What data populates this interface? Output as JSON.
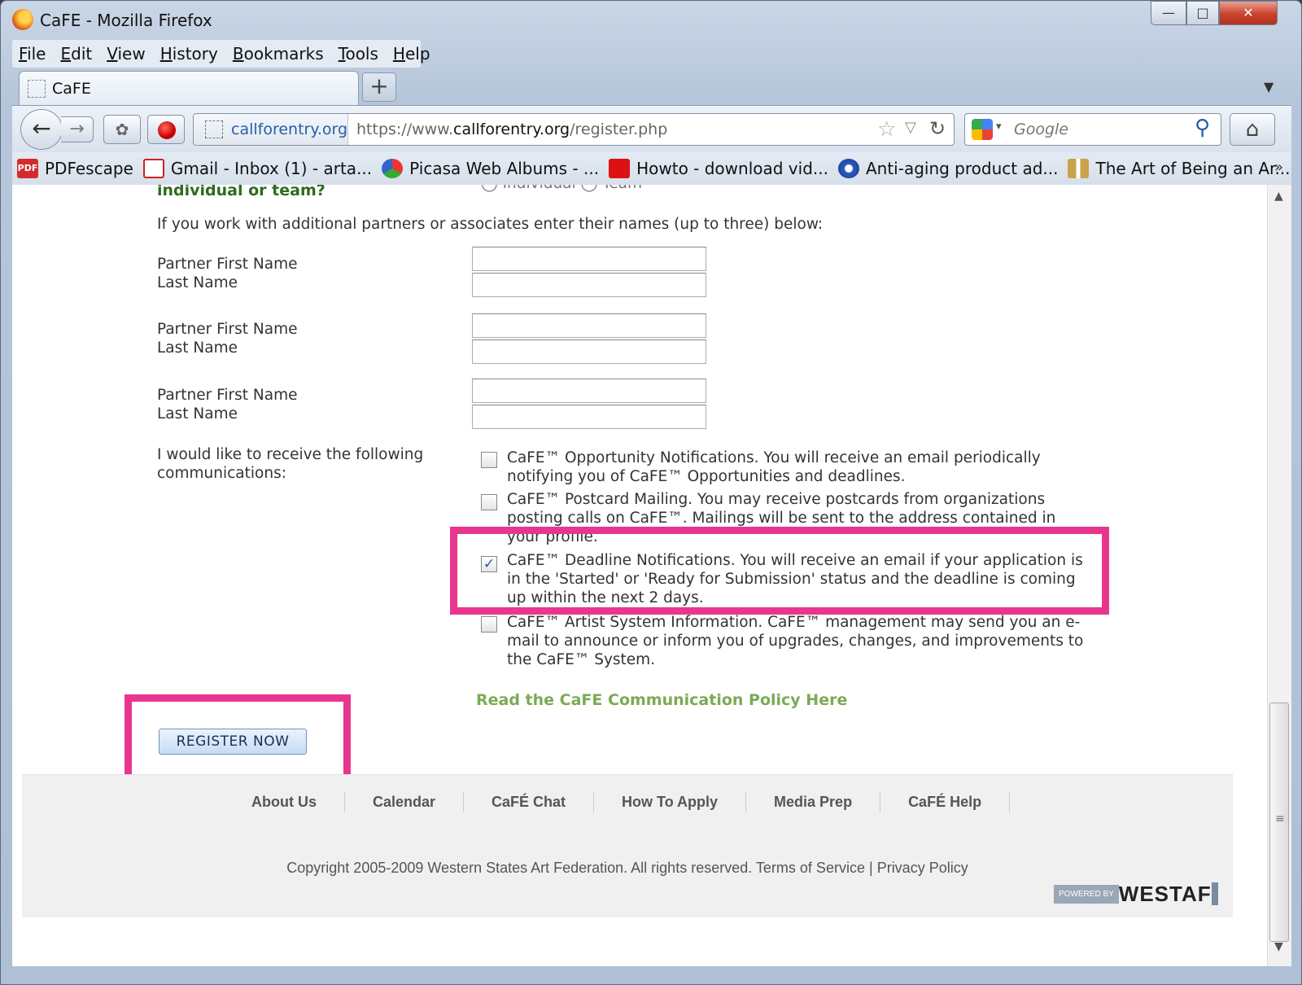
{
  "window": {
    "title": "CaFE - Mozilla Firefox",
    "minimize": "—",
    "maximize": "□",
    "close": "✕"
  },
  "menu": [
    "File",
    "Edit",
    "View",
    "History",
    "Bookmarks",
    "Tools",
    "Help"
  ],
  "tab": {
    "label": "CaFE",
    "new_tab": "+",
    "scroll": "▼"
  },
  "nav": {
    "back": "←",
    "forward": "→",
    "site_identity": "callforentry.org",
    "url_prefix": "https://www.",
    "url_domain": "callforentry.org",
    "url_path": "/register.php",
    "star": "☆",
    "dropdown": "▽",
    "reload": "↻",
    "search_placeholder": "Google",
    "search_dropdown": "▾",
    "search_icon": "⚲",
    "home": "⌂"
  },
  "bookmarks": [
    {
      "label": "PDFescape",
      "icon": "pdf-icon"
    },
    {
      "label": "Gmail - Inbox (1) - arta...",
      "icon": "gmail-icon"
    },
    {
      "label": "Picasa Web Albums - ...",
      "icon": "picasa-icon"
    },
    {
      "label": "Howto - download vid...",
      "icon": "youtube-icon"
    },
    {
      "label": "Anti-aging product ad...",
      "icon": "anti-aging-icon"
    },
    {
      "label": "The Art of Being an Ar...",
      "icon": "art-icon"
    }
  ],
  "bookmarks_more": "»",
  "page": {
    "team_question": "individual or team?",
    "team_radios": "◯ Individual ◯ Team",
    "partners_intro": "If you work with additional partners or associates enter their names (up to three) below:",
    "partner_first_label": "Partner First Name",
    "partner_last_label": "Last Name",
    "communications_label": "I would like to receive the following communications:",
    "options": [
      {
        "text": "CaFE™ Opportunity Notifications. You will receive an email periodically notifying you of CaFE™ Opportunities and deadlines.",
        "checked": false
      },
      {
        "text": "CaFE™ Postcard Mailing. You may receive postcards from organizations posting calls on CaFE™. Mailings will be sent to the address contained in your profile.",
        "checked": false
      },
      {
        "text": "CaFE™ Deadline Notifications. You will receive an email if your application is in the 'Started' or 'Ready for Submission' status and the deadline is coming up within the next 2 days.",
        "checked": true
      },
      {
        "text": "CaFE™ Artist System Information. CaFE™ management may send you an e-mail to announce or inform you of upgrades, changes, and improvements to the CaFE™ System.",
        "checked": false
      }
    ],
    "checkmark": "✓",
    "policy_link": "Read the CaFE Communication Policy Here",
    "register_button": "REGISTER NOW",
    "highlight_color": "#e8368f"
  },
  "footer": {
    "nav": [
      "About Us",
      "Calendar",
      "CaFÉ Chat",
      "How To Apply",
      "Media Prep",
      "CaFÉ Help"
    ],
    "copyright": "Copyright 2005-2009 Western States Art Federation. All rights reserved.",
    "terms": "Terms of Service",
    "separator": "|",
    "privacy": "Privacy Policy",
    "powered_by": "POWERED BY",
    "westaf": "WESTAF"
  },
  "scrollbar": {
    "up": "▲",
    "down": "▼",
    "grip": "≡"
  }
}
